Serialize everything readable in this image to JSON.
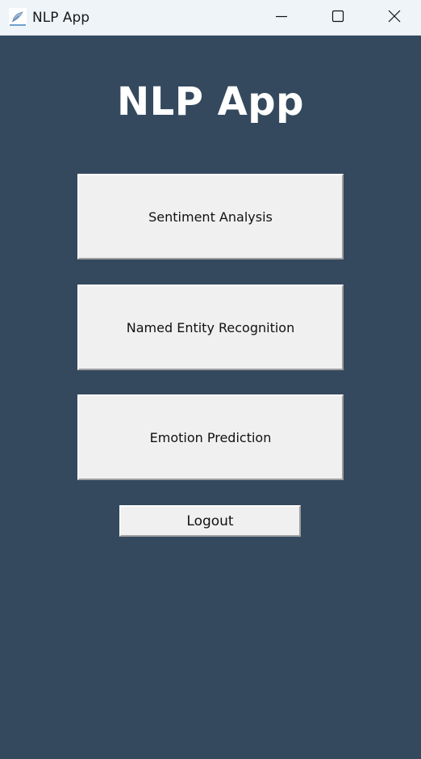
{
  "window": {
    "title": "NLP App",
    "icon": "feather-icon",
    "controls": [
      "minimize-icon",
      "maximize-icon",
      "close-icon"
    ]
  },
  "main": {
    "heading": "NLP App",
    "buttons": [
      {
        "label": "Sentiment Analysis"
      },
      {
        "label": "Named Entity Recognition"
      },
      {
        "label": "Emotion Prediction"
      }
    ],
    "logout_label": "Logout"
  },
  "colors": {
    "background": "#34495e",
    "titlebar": "#eff4f9",
    "button_face": "#f0f0f0",
    "heading_text": "#ffffff"
  }
}
